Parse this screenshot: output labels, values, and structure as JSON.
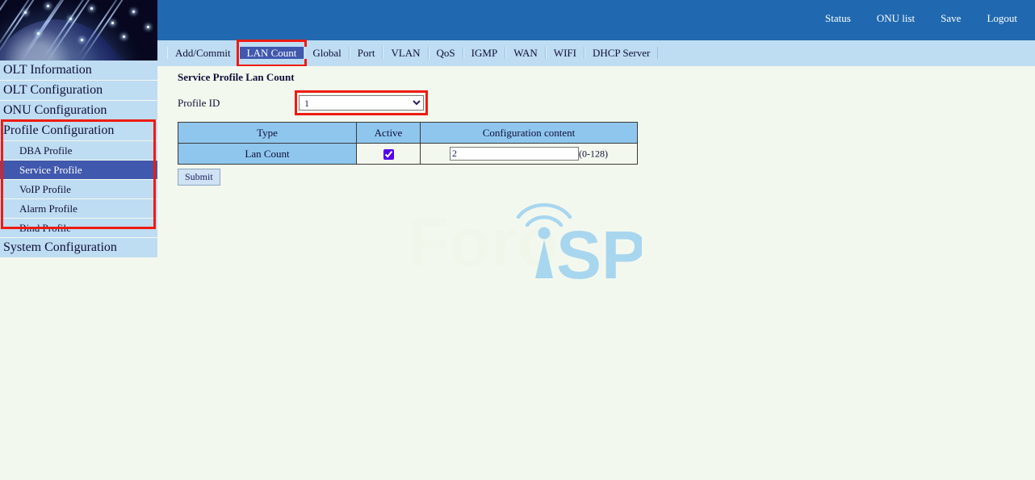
{
  "header": {
    "links": [
      {
        "label": "Status",
        "name": "status"
      },
      {
        "label": "ONU list",
        "name": "onu-list"
      },
      {
        "label": "Save",
        "name": "save"
      },
      {
        "label": "Logout",
        "name": "logout"
      }
    ]
  },
  "sidebar": {
    "items": [
      {
        "label": "OLT Information",
        "level": "top",
        "active": false
      },
      {
        "label": "OLT Configuration",
        "level": "top",
        "active": false
      },
      {
        "label": "ONU Configuration",
        "level": "top",
        "active": false
      },
      {
        "label": "Profile Configuration",
        "level": "top",
        "active": false
      },
      {
        "label": "DBA Profile",
        "level": "sub",
        "active": false
      },
      {
        "label": "Service Profile",
        "level": "sub",
        "active": true
      },
      {
        "label": "VoIP Profile",
        "level": "sub",
        "active": false
      },
      {
        "label": "Alarm Profile",
        "level": "sub",
        "active": false
      },
      {
        "label": "Bind Profile",
        "level": "sub",
        "active": false
      },
      {
        "label": "System Configuration",
        "level": "top",
        "active": false
      }
    ],
    "highlight_color": "#ee1b11",
    "active_color": "#4058ad"
  },
  "tabs": [
    {
      "label": "Add/Commit",
      "active": false
    },
    {
      "label": "LAN Count",
      "active": true
    },
    {
      "label": "Global",
      "active": false
    },
    {
      "label": "Port",
      "active": false
    },
    {
      "label": "VLAN",
      "active": false
    },
    {
      "label": "QoS",
      "active": false
    },
    {
      "label": "IGMP",
      "active": false
    },
    {
      "label": "WAN",
      "active": false
    },
    {
      "label": "WIFI",
      "active": false
    },
    {
      "label": "DHCP Server",
      "active": false
    }
  ],
  "main": {
    "title": "Service Profile Lan Count",
    "profile_id_label": "Profile ID",
    "profile_id_value": "1",
    "profile_id_options": [
      "1"
    ],
    "table": {
      "headers": [
        "Type",
        "Active",
        "Configuration content"
      ],
      "rows": [
        {
          "type": "Lan Count",
          "active_checked": true,
          "value": "2",
          "range_hint": "(0-128)"
        }
      ]
    },
    "submit_label": "Submit"
  },
  "watermark": {
    "text_left": "Foro",
    "text_right": "SP",
    "tower_letter": "i",
    "color": "#a9d6ef",
    "faded_color": "#f0f6ea"
  }
}
